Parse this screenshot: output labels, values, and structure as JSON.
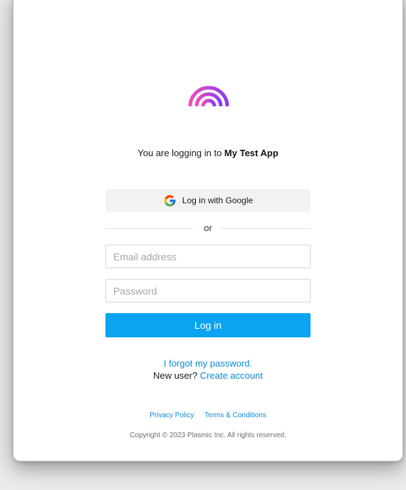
{
  "login": {
    "message_prefix": "You are logging in to",
    "app_name": "My Test App",
    "google_button_label": "Log in with Google",
    "divider_text": "or",
    "email_placeholder": "Email address",
    "email_value": "",
    "password_placeholder": "Password",
    "password_value": "",
    "login_button_label": "Log in",
    "forgot_password_link": "I forgot my password.",
    "new_user_prefix": "New user?",
    "create_account_link": "Create account"
  },
  "footer": {
    "privacy_policy": "Privacy Policy",
    "terms": "Terms & Conditions",
    "copyright": "Copyright © 2023 Plasmic Inc. All rights reserved."
  },
  "icons": {
    "logo": "rainbow-logo-icon",
    "google": "google-icon"
  },
  "colors": {
    "accent": "#0aa4f2",
    "link": "#0a8ad6",
    "logo_gradient_start": "#ee4dc0",
    "logo_gradient_end": "#8a3bef"
  }
}
